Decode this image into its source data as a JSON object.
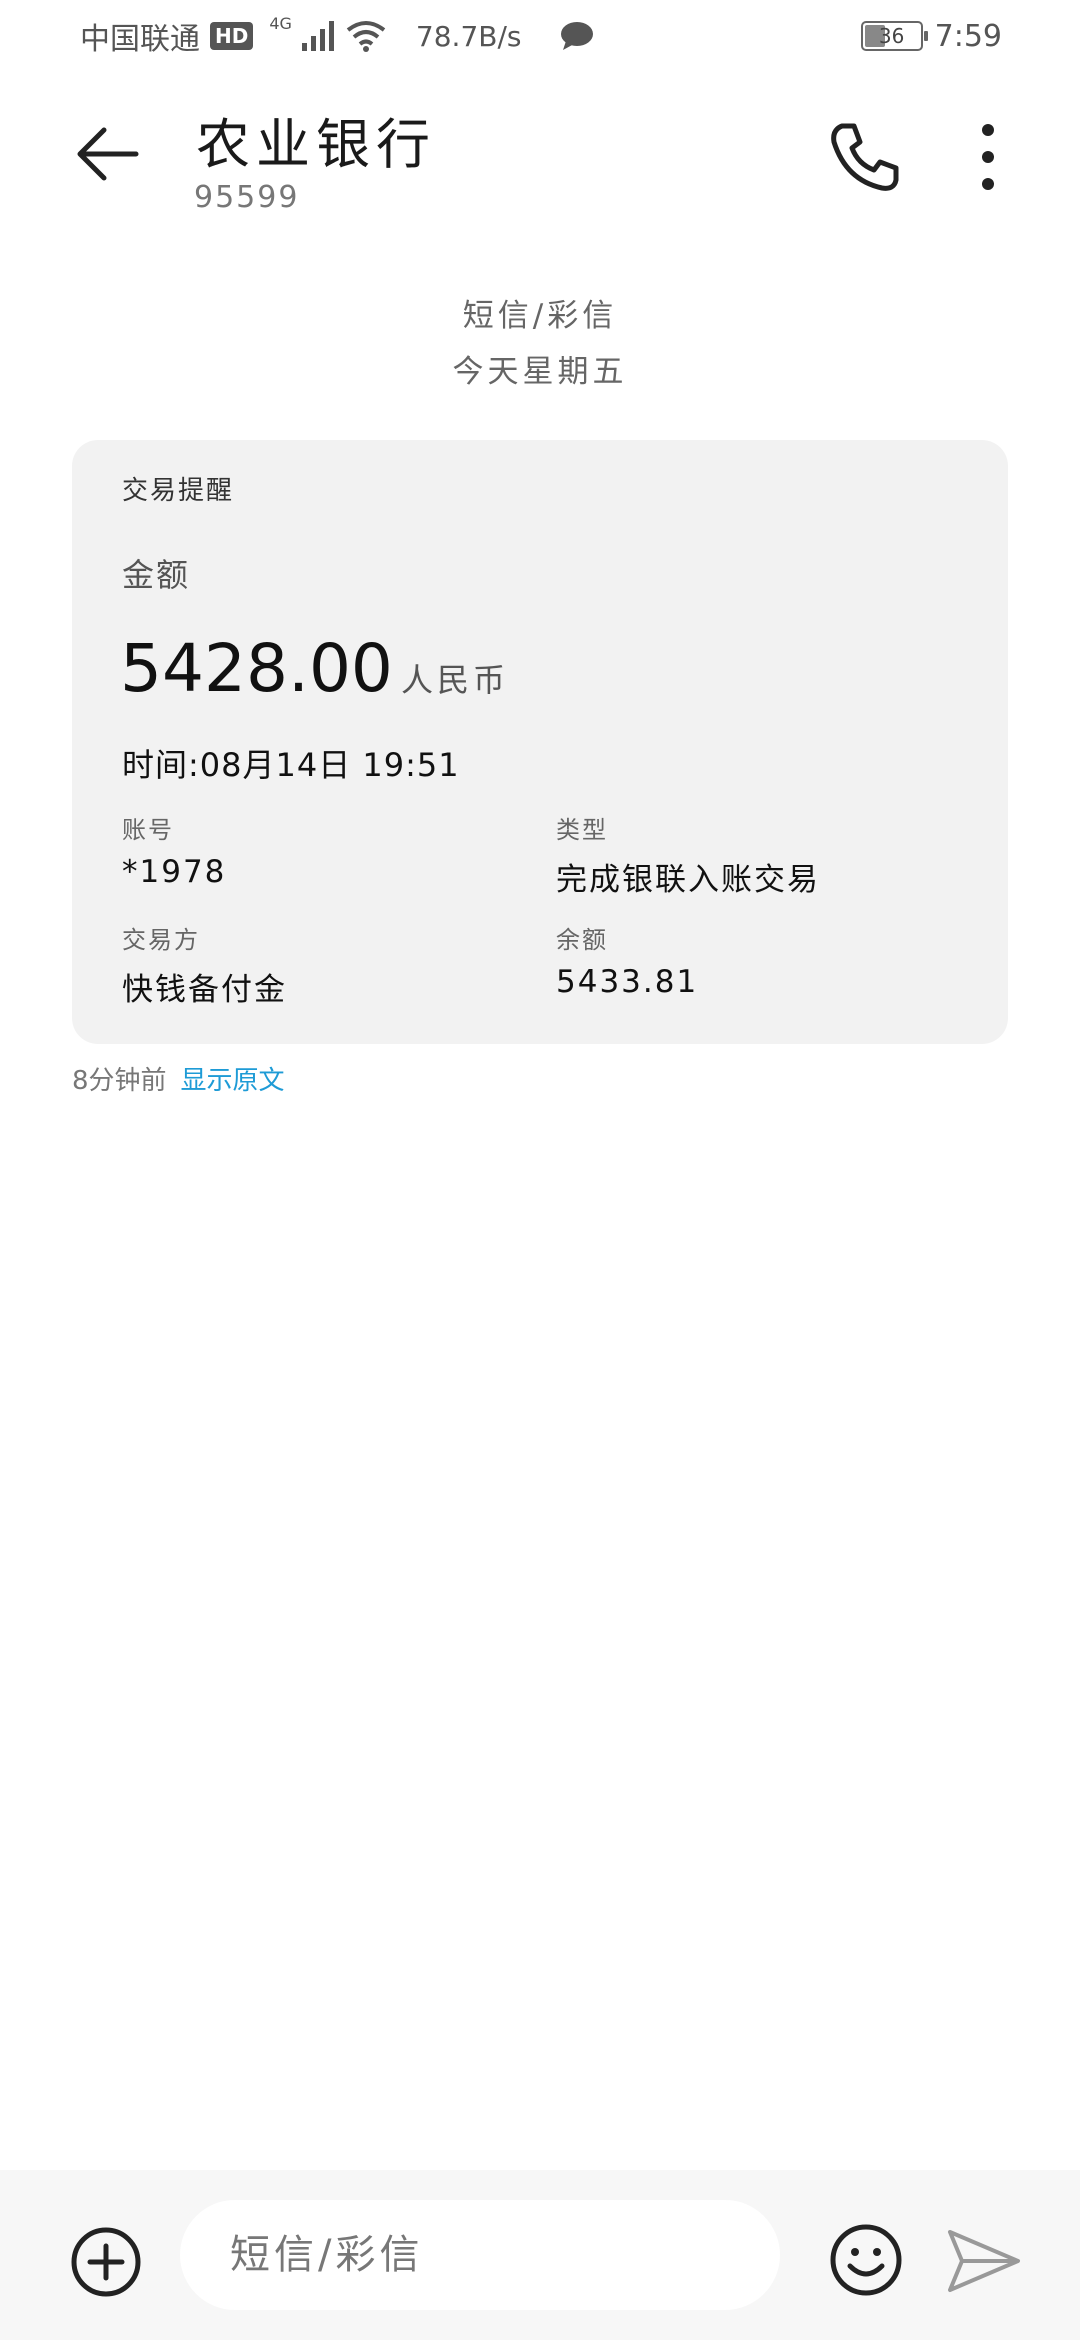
{
  "status_bar": {
    "carrier": "中国联通",
    "hd": "HD",
    "network": "4G",
    "speed": "78.7B/s",
    "battery": "36",
    "time": "7:59"
  },
  "header": {
    "title": "农业银行",
    "number": "95599"
  },
  "thread_meta": {
    "type": "短信/彩信",
    "day": "今天星期五"
  },
  "card": {
    "title": "交易提醒",
    "amount_label": "金额",
    "amount": "5428.00",
    "currency": "人民币",
    "time": "时间:08月14日  19:51",
    "account_label": "账号",
    "account_value": "*1978",
    "type_label": "类型",
    "type_value": "完成银联入账交易",
    "counterparty_label": "交易方",
    "counterparty_value": "快钱备付金",
    "balance_label": "余额",
    "balance_value": "5433.81"
  },
  "message_footer": {
    "ago": "8分钟前",
    "show_original": "显示原文"
  },
  "composer": {
    "placeholder": "短信/彩信"
  }
}
